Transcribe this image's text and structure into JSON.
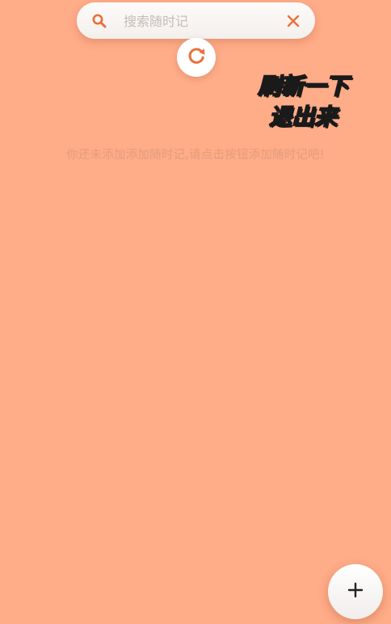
{
  "search": {
    "placeholder": "搜索随时记",
    "value": "",
    "icon": "search-icon",
    "clear_icon": "close-icon"
  },
  "refresh": {
    "icon": "refresh-icon"
  },
  "overlay_caption": {
    "line1": "刷新一下",
    "line2": "退出来"
  },
  "empty_state": {
    "message": "你还未添加添加随时记,请点击按钮添加随时记吧!"
  },
  "fab": {
    "icon": "plus-icon",
    "label": "+"
  },
  "colors": {
    "background": "#ffac88",
    "accent": "#e8713a",
    "hint_text": "#e39c7d"
  }
}
